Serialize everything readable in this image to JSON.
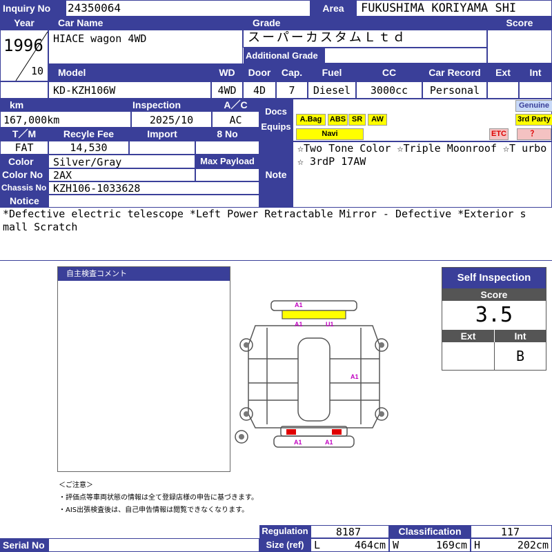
{
  "labels": {
    "inquiry_no": "Inquiry No",
    "area": "Area",
    "year": "Year",
    "car_name": "Car Name",
    "grade": "Grade",
    "score": "Score",
    "additional_grade": "Additional Grade",
    "model": "Model",
    "wd": "WD",
    "door": "Door",
    "cap": "Cap.",
    "fuel": "Fuel",
    "cc": "CC",
    "car_record": "Car Record",
    "ext": "Ext",
    "int": "Int",
    "km": "km",
    "inspection": "Inspection",
    "ac": "A／C",
    "docs": "Docs",
    "equips": "Equips",
    "genuine": "Genuine",
    "third_party": "3rd Party",
    "tm": "T／M",
    "recycle_fee": "Recyle Fee",
    "import": "Import",
    "no": "8 No",
    "color": "Color",
    "max_payload": "Max Payload",
    "color_no": "Color No",
    "chassis_no": "Chassis No",
    "notice": "Notice",
    "note": "Note",
    "regulation": "Regulation",
    "classification": "Classification",
    "size_ref": "Size (ref)",
    "serial_no": "Serial No",
    "l": "L",
    "w": "W",
    "h": "H"
  },
  "vehicle": {
    "inquiry_no": "24350064",
    "area": "FUKUSHIMA KORIYAMA SHI",
    "year": "1996",
    "month": "10",
    "car_name": "HIACE wagon 4WD",
    "grade": "スーパーカスタムＬｔｄ",
    "model": "KD-KZH106W",
    "wd": "4WD",
    "door": "4D",
    "cap": "7",
    "fuel": "Diesel",
    "cc": "3000cc",
    "car_record": "Personal",
    "km": "167,000km",
    "inspection": "2025/10",
    "ac": "AC",
    "tm": "FAT",
    "recycle_fee": "14,530",
    "color": "Silver/Gray",
    "color_no": "2AX",
    "chassis_no": "KZH106-1033628",
    "note": "☆Two Tone Color ☆Triple Moonroof ☆T urbo ☆ 3rdP 17AW",
    "notice": "*Defective electric telescope *Left Power Retractable Mirror - Defective *Exterior s mall Scratch",
    "regulation": "8187",
    "classification": "117",
    "size_l": "464cm",
    "size_w": "169cm",
    "size_h": "202cm"
  },
  "equips": {
    "abag": "A.Bag",
    "abs": "ABS",
    "sr": "SR",
    "aw": "AW",
    "navi": "Navi",
    "etc": "ETC",
    "unknown": "？"
  },
  "inspection_sheet": {
    "comment_title": "自主検査コメント",
    "self_inspection": "Self Inspection",
    "score_label": "Score",
    "score": "3.5",
    "ext_label": "Ext",
    "int_label": "Int",
    "int": "B",
    "marks": [
      "A1",
      "A1",
      "U1",
      "A1",
      "A1",
      "A1"
    ],
    "notes_title": "＜ご注意＞",
    "note1": "・評価点等車両状態の情報は全て登録店様の申告に基づきます。",
    "note2": "・AIS出張検査後は、自己申告情報は閲覧できなくなります。"
  },
  "colors": {
    "header": "#3a3f99",
    "highlight": "#ffff00",
    "damage_red": "#e00000",
    "mark": "#c000c0"
  }
}
